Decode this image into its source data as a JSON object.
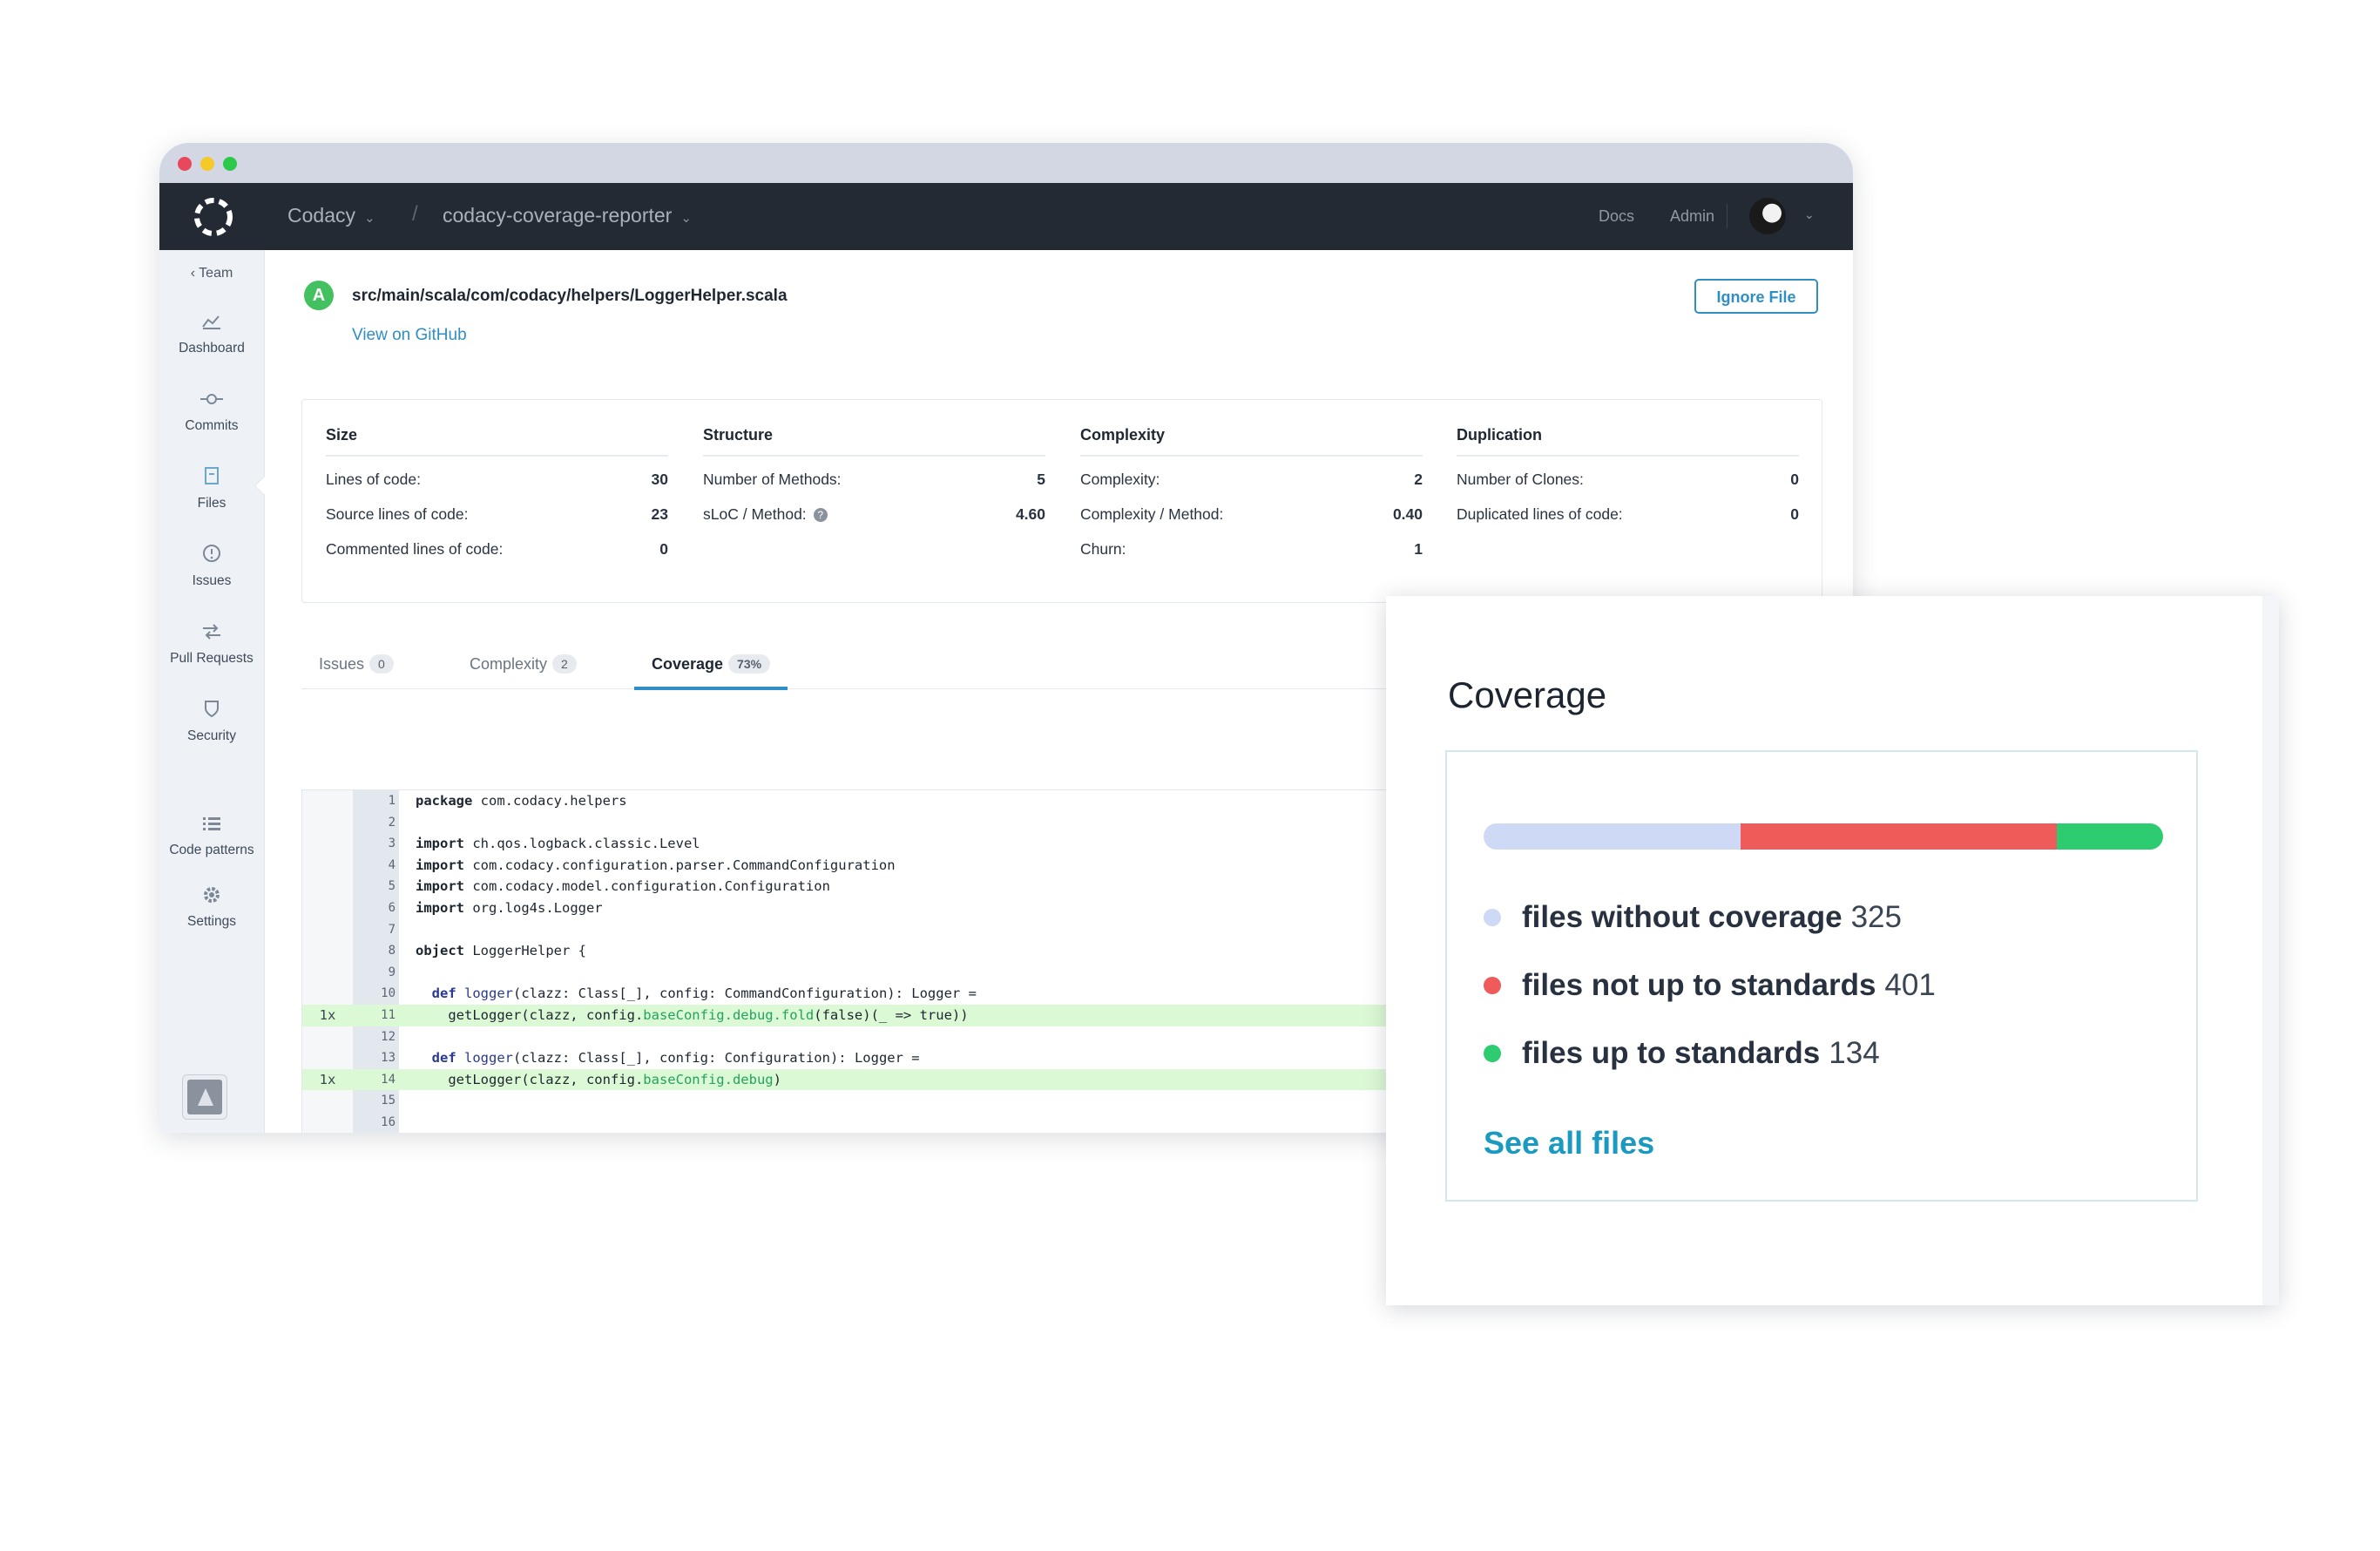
{
  "window": {
    "controls": [
      "close",
      "minimize",
      "maximize"
    ]
  },
  "topbar": {
    "org": "Codacy",
    "separator": "/",
    "repo": "codacy-coverage-reporter",
    "links": [
      "Docs",
      "Admin"
    ],
    "chevron": "⌄"
  },
  "sidebar": {
    "back": "‹ Team",
    "items": [
      {
        "label": "Dashboard",
        "icon": "chart-icon"
      },
      {
        "label": "Commits",
        "icon": "commit-icon"
      },
      {
        "label": "Files",
        "icon": "file-icon"
      },
      {
        "label": "Issues",
        "icon": "alert-circle-icon"
      },
      {
        "label": "Pull Requests",
        "icon": "pull-request-icon"
      },
      {
        "label": "Security",
        "icon": "shield-icon"
      },
      {
        "label": "Code patterns",
        "icon": "list-icon"
      },
      {
        "label": "Settings",
        "icon": "gear-icon"
      }
    ]
  },
  "file": {
    "grade": "A",
    "path": "src/main/scala/com/codacy/helpers/LoggerHelper.scala",
    "github_link": "View on GitHub",
    "ignore_button": "Ignore File"
  },
  "metrics": {
    "size": {
      "title": "Size",
      "rows": [
        {
          "label": "Lines of code:",
          "value": "30"
        },
        {
          "label": "Source lines of code:",
          "value": "23"
        },
        {
          "label": "Commented lines of code:",
          "value": "0"
        }
      ]
    },
    "structure": {
      "title": "Structure",
      "rows": [
        {
          "label": "Number of Methods:",
          "value": "5"
        },
        {
          "label": "sLoC / Method:",
          "value": "4.60"
        }
      ]
    },
    "complexity": {
      "title": "Complexity",
      "rows": [
        {
          "label": "Complexity:",
          "value": "2"
        },
        {
          "label": "Complexity / Method:",
          "value": "0.40"
        },
        {
          "label": "Churn:",
          "value": "1"
        }
      ]
    },
    "duplication": {
      "title": "Duplication",
      "rows": [
        {
          "label": "Number of Clones:",
          "value": "0"
        },
        {
          "label": "Duplicated lines of code:",
          "value": "0"
        }
      ]
    }
  },
  "tabs": [
    {
      "label": "Issues",
      "badge": "0"
    },
    {
      "label": "Complexity",
      "badge": "2"
    },
    {
      "label": "Coverage",
      "badge": "73%",
      "active": true
    }
  ],
  "code": {
    "lines": [
      {
        "n": "1",
        "text": "package com.codacy.helpers"
      },
      {
        "n": "2",
        "text": ""
      },
      {
        "n": "3",
        "text": "import ch.qos.logback.classic.Level"
      },
      {
        "n": "4",
        "text": "import com.codacy.configuration.parser.CommandConfiguration"
      },
      {
        "n": "5",
        "text": "import com.codacy.model.configuration.Configuration"
      },
      {
        "n": "6",
        "text": "import org.log4s.Logger"
      },
      {
        "n": "7",
        "text": ""
      },
      {
        "n": "8",
        "text": "object LoggerHelper {"
      },
      {
        "n": "9",
        "text": ""
      },
      {
        "n": "10",
        "text": "  def logger(clazz: Class[_], config: CommandConfiguration): Logger ="
      },
      {
        "n": "11",
        "text": "    getLogger(clazz, config.baseConfig.debug.fold(false)(_ => true))",
        "hits": "1x"
      },
      {
        "n": "12",
        "text": ""
      },
      {
        "n": "13",
        "text": "  def logger(clazz: Class[_], config: Configuration): Logger ="
      },
      {
        "n": "14",
        "text": "    getLogger(clazz, config.baseConfig.debug)",
        "hits": "1x"
      },
      {
        "n": "15",
        "text": ""
      },
      {
        "n": "16",
        "text": ""
      }
    ]
  },
  "coverage_card": {
    "title": "Coverage",
    "segments": [
      {
        "label": "files without coverage",
        "count": "325",
        "color": "#cdd9f5"
      },
      {
        "label": "files not up to standards",
        "count": "401",
        "color": "#ef5b5b"
      },
      {
        "label": "files up to standards",
        "count": "134",
        "color": "#2ecc71"
      }
    ],
    "link": "See all files"
  }
}
